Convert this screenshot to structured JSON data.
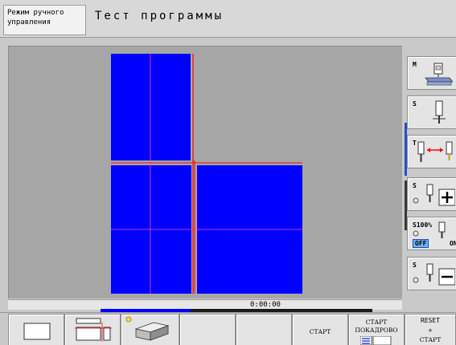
{
  "header": {
    "mode": "Режим ручного\nуправления",
    "title": "Тест программы"
  },
  "status": {
    "time": "0:00:00",
    "progress_fraction": 0.33
  },
  "side_softkeys": [
    {
      "id": "m",
      "label": "M"
    },
    {
      "id": "s",
      "label": "S"
    },
    {
      "id": "t",
      "label": "T"
    },
    {
      "id": "s-plus",
      "label": "S"
    },
    {
      "id": "s-override",
      "label": "S100%",
      "off": "OFF",
      "on": "ON"
    },
    {
      "id": "s-minus",
      "label": "S"
    }
  ],
  "bottom_softkeys": [
    {
      "id": "start",
      "label": "СТАРТ"
    },
    {
      "id": "start-single",
      "line1": "СТАРТ",
      "line2": "ПОКАДРОВО"
    },
    {
      "id": "reset-start",
      "line1": "RESET",
      "line2": "+",
      "line3": "СТАРТ"
    }
  ],
  "colors": {
    "workpiece": "#0000ff",
    "tool_path": "#ff0000",
    "viewport_bg": "#a6a6a6"
  }
}
